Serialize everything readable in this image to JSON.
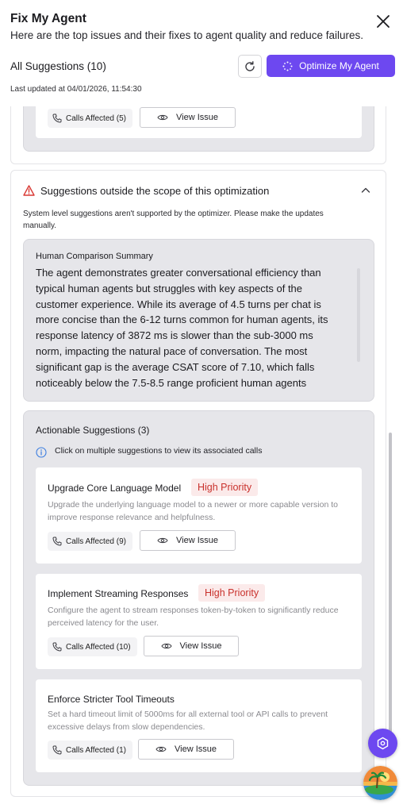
{
  "header": {
    "title": "Fix My Agent",
    "subtitle": "Here are the top issues and their fixes to agent quality and reduce failures.",
    "all_suggestions": "All Suggestions (10)",
    "optimize_label": "Optimize My Agent",
    "last_updated": "Last updated at 04/01/2026, 11:54:30"
  },
  "top_card": {
    "calls_label": "Calls Affected (5)",
    "view_label": "View Issue"
  },
  "out_of_scope": {
    "title": "Suggestions outside the scope of this optimization",
    "note": "System level suggestions aren't supported by the optimizer. Please make the updates manually.",
    "summary_heading": "Human Comparison Summary",
    "summary_text": "The agent demonstrates greater conversational efficiency than typical human agents but struggles with key aspects of the customer experience. While its average of 4.5 turns per chat is more concise than the 6-12 turns common for human agents, its response latency of 3872 ms is slower than the sub-3000 ms norm, impacting the natural pace of conversation. The most significant gap is the average CSAT score of 7.10, which falls noticeably below the 7.5-8.5 range proficient human agents",
    "actionable_heading": "Actionable Suggestions (3)",
    "actionable_note": "Click on multiple suggestions to view its associated calls",
    "suggestions": [
      {
        "title": "Upgrade Core Language Model",
        "priority": "High Priority",
        "description": "Upgrade the underlying language model to a newer or more capable version to improve response relevance and helpfulness.",
        "calls_label": "Calls Affected (9)",
        "view_label": "View Issue"
      },
      {
        "title": "Implement Streaming Responses",
        "priority": "High Priority",
        "description": "Configure the agent to stream responses token-by-token to significantly reduce perceived latency for the user.",
        "calls_label": "Calls Affected (10)",
        "view_label": "View Issue"
      },
      {
        "title": "Enforce Stricter Tool Timeouts",
        "priority": "",
        "description": "Set a hard timeout limit of 5000ms for all external tool or API calls to prevent excessive delays from slow dependencies.",
        "calls_label": "Calls Affected (1)",
        "view_label": "View Issue"
      }
    ]
  },
  "colors": {
    "accent": "#6d48f0",
    "priority_text": "#c9312c",
    "priority_bg": "#fbeaea",
    "warning": "#d93a35",
    "info": "#3b7de0"
  },
  "icons": [
    "close-icon",
    "refresh-icon",
    "sparkle-icon",
    "phone-icon",
    "eye-icon",
    "warning-icon",
    "chevron-up-icon",
    "info-icon",
    "assistant-icon",
    "avatar-image"
  ]
}
